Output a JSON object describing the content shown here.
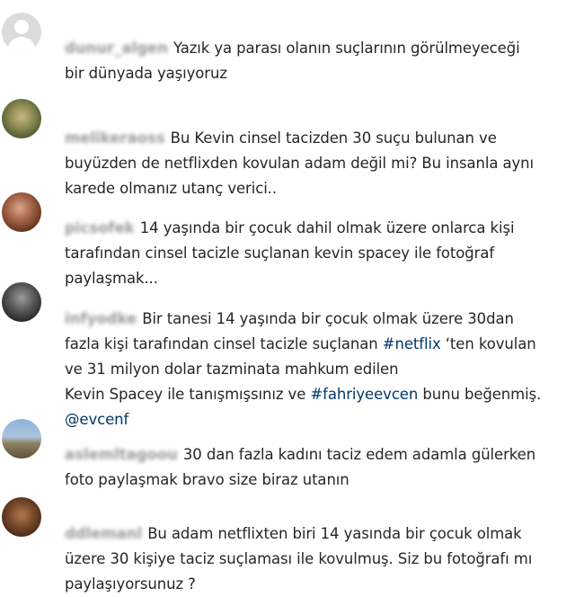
{
  "comments": [
    {
      "username": "dunur_algen",
      "text": "Yazık ya parası olanın suçlarının görülmeyeceği\nbir dünyada yaşıyoruz"
    },
    {
      "username": "melikeraoss",
      "text": "Bu Kevin cinsel tacizden 30 suçu bulunan ve\nbuyüzden de netflixden kovulan adam değil mi? Bu insanla aynı\nkarede olmanız utanç verici.."
    },
    {
      "username": "picsofek",
      "text": "14 yaşında bir çocuk dahil olmak üzere onlarca kişi\ntarafından cinsel tacizle suçlanan kevin spacey ile fotoğraf\npaylaşmak..."
    },
    {
      "username": "infyodke",
      "text_part1": "Bir tanesi 14 yaşında bir çocuk olmak üzere 30dan\nfazla kişi tarafından cinsel tacizle suçlanan ",
      "hashtag1": "#netflix",
      "text_part2": " ‘ten kovulan\nve 31 milyon dolar tazminata mahkum edilen\nKevin Spacey ile tanışmışsınız ve ",
      "hashtag2": "#fahriyeevcen",
      "text_part3": " bunu beğenmiş.\n",
      "mention": "@evcenf"
    },
    {
      "username": "aslemltagoou",
      "text": "30 dan fazla kadını taciz edem adamla gülerken\nfoto paylaşmak bravo size biraz utanın"
    },
    {
      "username": "ddlemanl",
      "text": "Bu adam netflixten biri 14 yasında bir çocuk olmak\nüzere 30 kişiye taciz suçlaması ile kovulmuş. Siz bu fotoğrafı mı\npaylaşıyorsunuz ?"
    }
  ],
  "colors": {
    "hashtag": "#00376b",
    "text": "#262626"
  }
}
